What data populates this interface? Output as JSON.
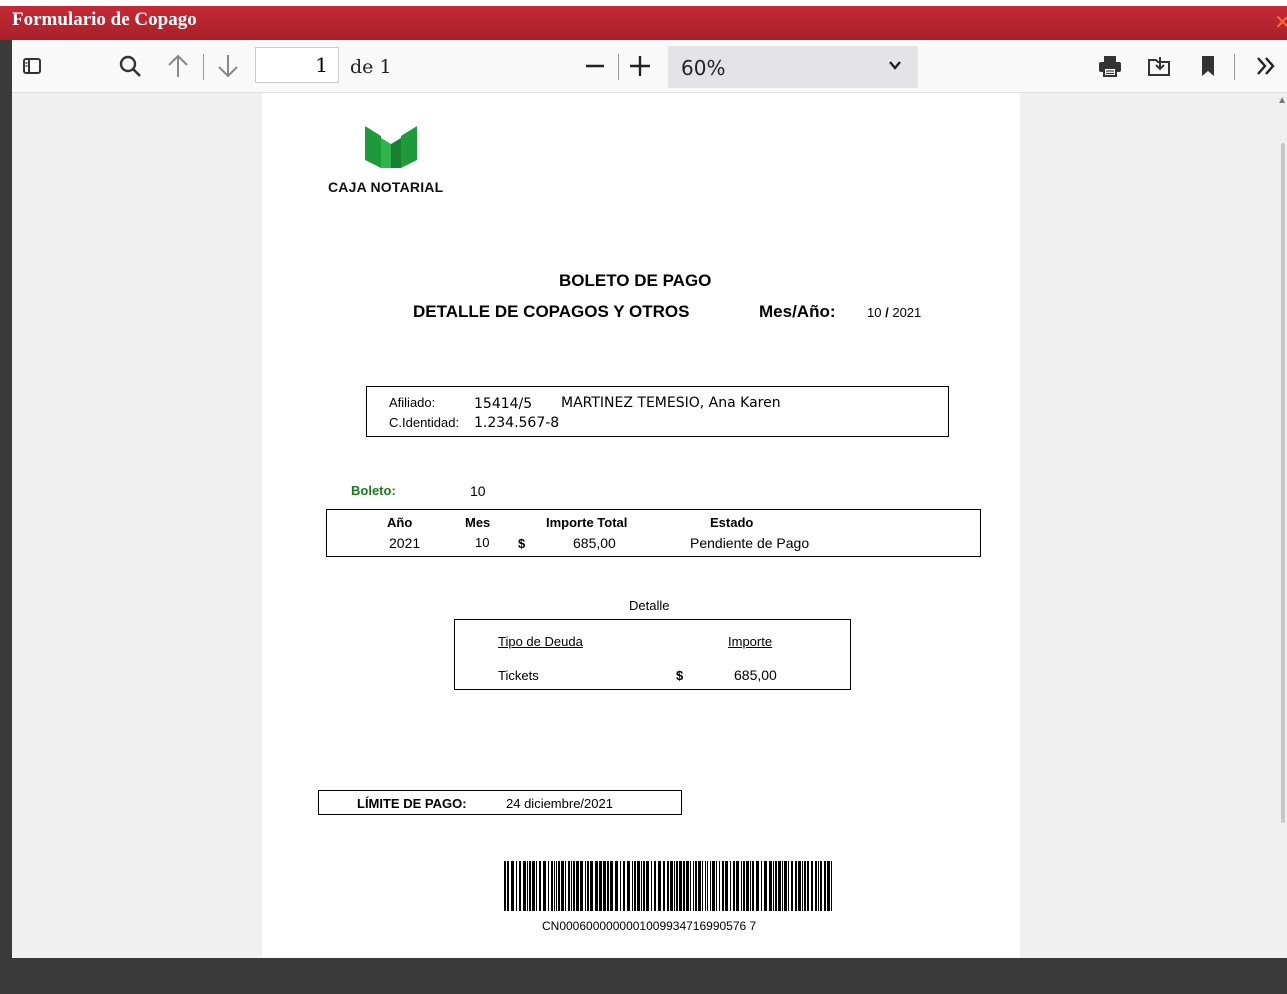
{
  "window": {
    "title": "Formulario de Copago",
    "close_glyph": "✕"
  },
  "toolbar": {
    "icons": {
      "sidebar": "sidebar-toggle-icon",
      "find": "search-icon",
      "prev": "arrow-up-icon",
      "next": "arrow-down-icon",
      "zoom_out": "minus-icon",
      "zoom_in": "plus-icon",
      "print": "printer-icon",
      "save": "save-icon",
      "bookmark": "bookmark-icon",
      "more": "double-chevron-right-icon"
    },
    "page_number": "1",
    "page_count_label": "de 1",
    "zoom_value": "60%"
  },
  "document": {
    "logo_text": "CAJA NOTARIAL",
    "title": "BOLETO DE PAGO",
    "subtitle": "DETALLE DE COPAGOS Y OTROS",
    "period_label": "Mes/Año:",
    "period_month": "10",
    "period_sep": "/",
    "period_year": "2021",
    "affiliate": {
      "label": "Afiliado:",
      "number": "15414/5",
      "name": "MARTINEZ TEMESIO, Ana Karen",
      "id_label": "C.Identidad:",
      "id_value": "1.234.567-8"
    },
    "ticket": {
      "label": "Boleto:",
      "value": "10"
    },
    "summary": {
      "headers": {
        "year": "Año",
        "month": "Mes",
        "total": "Importe Total",
        "status": "Estado"
      },
      "row": {
        "year": "2021",
        "month": "10",
        "currency": "$",
        "total": "685,00",
        "status": "Pendiente de Pago"
      }
    },
    "detail": {
      "title": "Detalle",
      "headers": {
        "type": "Tipo de Deuda",
        "amount": "Importe"
      },
      "rows": [
        {
          "type": "Tickets",
          "currency": "$",
          "amount": "685,00"
        }
      ]
    },
    "due": {
      "label": "LÍMITE DE PAGO:",
      "value": "24 diciembre/2021"
    },
    "barcode_text": "CN0006000000001009934716990576 7"
  },
  "colors": {
    "titlebar": "#b5232e",
    "logo_green": "#1e9a3a",
    "ticket_label": "#1a7a1a"
  }
}
